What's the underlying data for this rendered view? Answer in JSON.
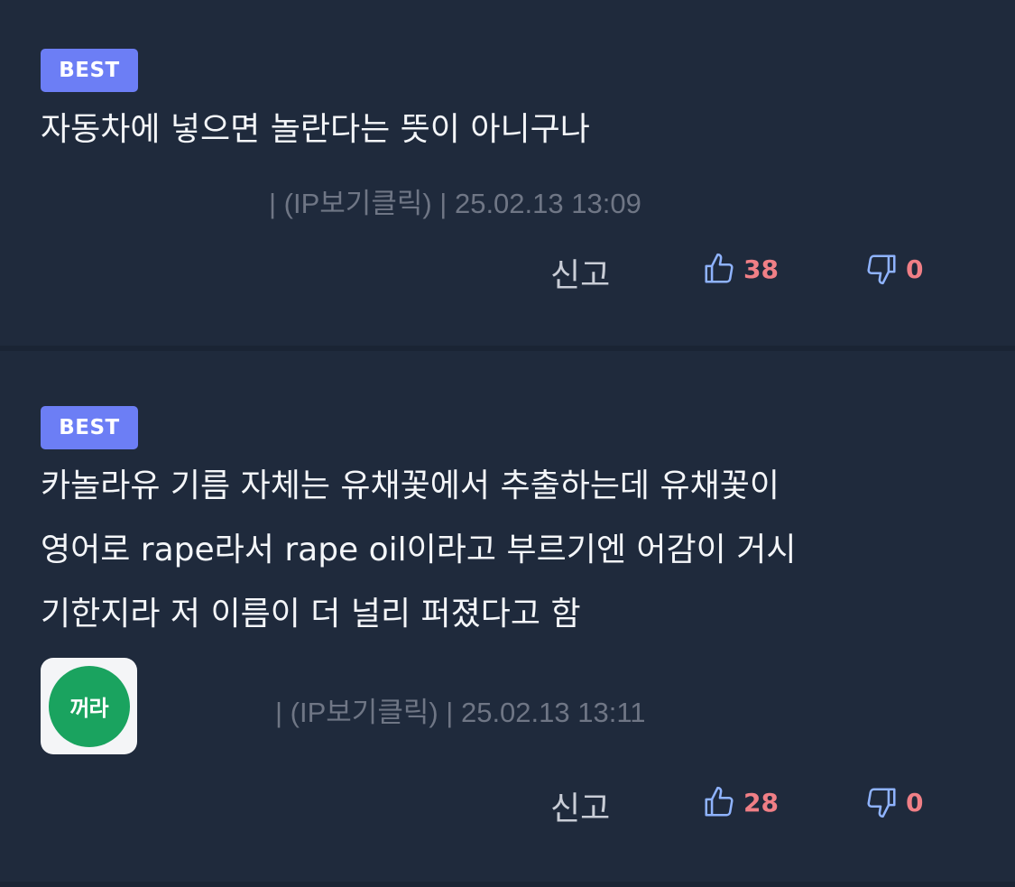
{
  "comments": [
    {
      "badge": "BEST",
      "text": "자동차에 넣으면 놀란다는 뜻이 아니구나",
      "meta": "| (IP보기클릭) | 25.02.13 13:09",
      "report_label": "신고",
      "likes": "38",
      "dislikes": "0"
    },
    {
      "badge": "BEST",
      "text": "카놀라유 기름 자체는 유채꽃에서 추출하는데 유채꽃이\n영어로 rape라서 rape oil이라고 부르기엔 어감이 거시\n기한지라 저 이름이 더 널리 퍼졌다고 함",
      "avatar_text": "꺼라",
      "meta": "| (IP보기클릭) | 25.02.13 13:11",
      "report_label": "신고",
      "likes": "28",
      "dislikes": "0"
    }
  ],
  "colors": {
    "background": "#1f2a3c",
    "badge": "#6c7ef5",
    "like_icon": "#8fb3ff",
    "count": "#f07f86",
    "meta": "#6f7685"
  },
  "icons": {
    "like": "thumbs-up-icon",
    "dislike": "thumbs-down-icon"
  }
}
